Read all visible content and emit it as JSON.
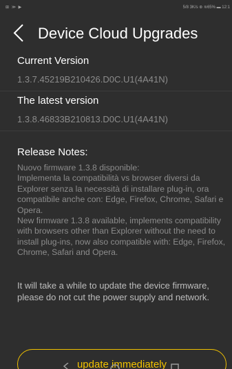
{
  "status_bar": {
    "left_icons": "⊞ ≫ ▶",
    "right_text": "5/8 3K/s ⊛ ≋65% ▬ 12:1"
  },
  "header": {
    "title": "Device Cloud Upgrades"
  },
  "current_version": {
    "label": "Current Version",
    "value": "1.3.7.45219B210426.D0C.U1(4A41N)"
  },
  "latest_version": {
    "label": "The latest version",
    "value": "1.3.8.46833B210813.D0C.U1(4A41N)"
  },
  "release_notes": {
    "title": "Release Notes:",
    "text": "Nuovo firmware 1.3.8 disponible:\nImplementa la compatibilità vs browser diversi da Explorer senza la necessità di installare plug-in, ora compatibile anche con: Edge, Firefox, Chrome, Safari e Opera.\nNew firmware 1.3.8 available, implements compatibility with browsers other than Explorer without the need to install plug-ins, now also compatible with: Edge, Firefox, Chrome, Safari and Opera."
  },
  "notice": "It will take a while to update the device firmware, please do not cut the power supply and network.",
  "update_button": {
    "label": "update immediately"
  },
  "colors": {
    "background": "#2e2e2e",
    "accent": "#f2c200",
    "muted_text": "#8c8c8c"
  },
  "icons": {
    "back": "chevron-left-icon",
    "nav_back": "triangle-back-icon",
    "nav_home": "circle-home-icon",
    "nav_recents": "square-recents-icon"
  }
}
